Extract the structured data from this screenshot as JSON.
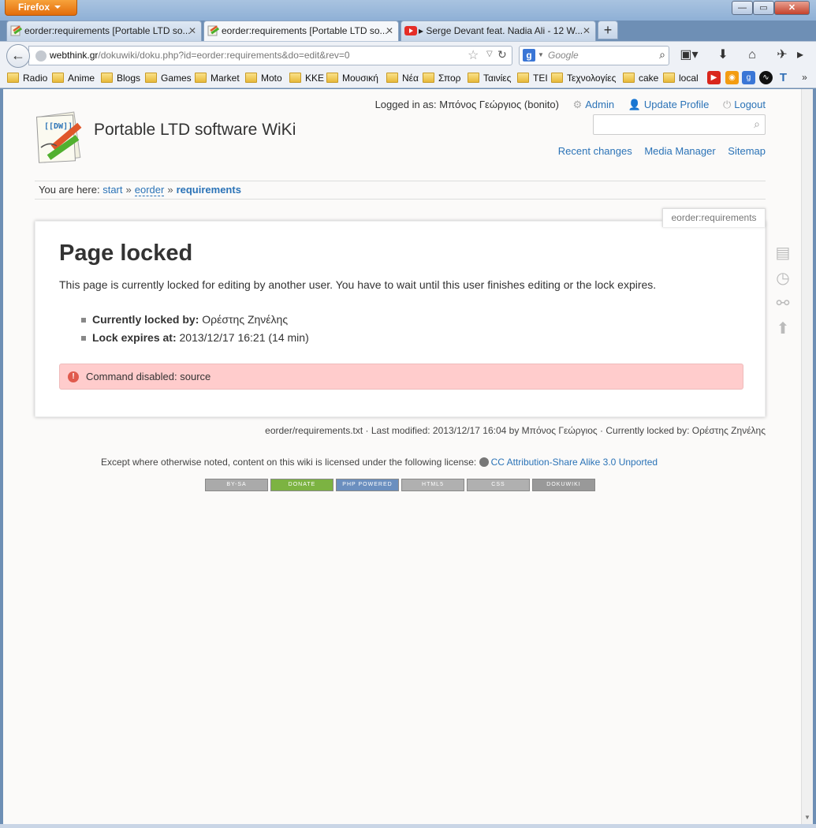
{
  "window": {
    "app_button": "Firefox",
    "min": "—",
    "max": "▭",
    "close": "✕"
  },
  "tabs": [
    {
      "title": "eorder:requirements [Portable LTD so...",
      "active": false
    },
    {
      "title": "eorder:requirements [Portable LTD so...",
      "active": true
    },
    {
      "title": "▸ Serge Devant feat. Nadia Ali - 12 W...",
      "active": false
    }
  ],
  "tab_close": "✕",
  "new_tab": "+",
  "nav": {
    "back": "←",
    "url_host": "webthink.gr",
    "url_path": "/dokuwiki/doku.php?id=eorder:requirements&do=edit&rev=0",
    "search_placeholder": "Google",
    "search_engine": "g"
  },
  "bookmarks": [
    "Radio",
    "Anime",
    "Blogs",
    "Games",
    "Market",
    "Moto",
    "KKE",
    "Μουσική",
    "Νέα",
    "Σπορ",
    "Ταινίες",
    "TEI",
    "Τεχνολογίες",
    "cake",
    "local"
  ],
  "wiki": {
    "user_prefix": "Logged in as: Μπόνος Γεώργιος (bonito)",
    "admin": "Admin",
    "update_profile": "Update Profile",
    "logout": "Logout",
    "logo_text": "[[DW]]",
    "site_title": "Portable LTD software WiKi",
    "recent_changes": "Recent changes",
    "media_manager": "Media Manager",
    "sitemap": "Sitemap",
    "breadcrumb": {
      "prefix": "You are here:",
      "start": "start",
      "eorder": "eorder",
      "current": "requirements",
      "sep": "»"
    },
    "page_id": "eorder:requirements",
    "heading": "Page locked",
    "message": "This page is currently locked for editing by another user. You have to wait until this user finishes editing or the lock expires.",
    "locked_by_label": "Currently locked by:",
    "locked_by_value": "Ορέστης Ζηνέλης",
    "lock_expires_label": "Lock expires at:",
    "lock_expires_value": "2013/12/17 16:21 (14 min)",
    "error": "Command disabled: source",
    "page_info": "eorder/requirements.txt · Last modified: 2013/12/17 16:04 by Μπόνος Γεώργιος · Currently locked by: Ορέστης Ζηνέλης",
    "license_prefix": "Except where otherwise noted, content on this wiki is licensed under the following license:",
    "license_link": "CC Attribution-Share Alike 3.0 Unported",
    "badges": [
      "BY-SA",
      "DONATE",
      "PHP POWERED",
      "HTML5",
      "CSS",
      "DOKUWIKI"
    ]
  },
  "colors": {
    "link": "#2b73b7",
    "error_bg": "#ffcccc",
    "firefox_orange": "#e36d0b"
  }
}
